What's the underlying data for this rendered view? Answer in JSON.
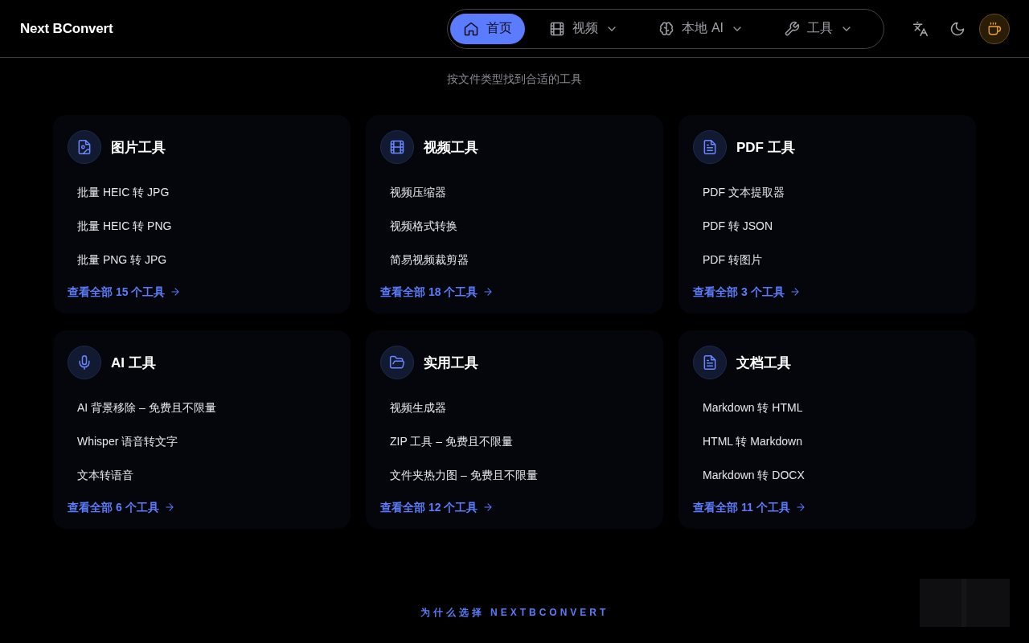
{
  "header": {
    "logo": "Next BConvert",
    "nav": [
      {
        "label": "首页",
        "selected": true,
        "dropdown": false
      },
      {
        "label": "视频",
        "selected": false,
        "dropdown": true
      },
      {
        "label": "本地 AI",
        "selected": false,
        "dropdown": true
      },
      {
        "label": "工具",
        "selected": false,
        "dropdown": true
      }
    ]
  },
  "section": {
    "subtitle": "按文件类型找到合适的工具"
  },
  "categories": [
    {
      "title": "图片工具",
      "tools": [
        "批量 HEIC 转 JPG",
        "批量 HEIC 转 PNG",
        "批量 PNG 转 JPG"
      ],
      "link": "查看全部 15 个工具"
    },
    {
      "title": "视频工具",
      "tools": [
        "视频压缩器",
        "视频格式转换",
        "简易视频裁剪器"
      ],
      "link": "查看全部 18 个工具"
    },
    {
      "title": "PDF 工具",
      "tools": [
        "PDF 文本提取器",
        "PDF 转 JSON",
        "PDF 转图片"
      ],
      "link": "查看全部 3 个工具"
    },
    {
      "title": "AI 工具",
      "tools": [
        "AI 背景移除 – 免费且不限量",
        "Whisper 语音转文字",
        "文本转语音"
      ],
      "link": "查看全部 6 个工具"
    },
    {
      "title": "实用工具",
      "tools": [
        "视频生成器",
        "ZIP 工具 – 免费且不限量",
        "文件夹热力图 – 免费且不限量"
      ],
      "link": "查看全部 12 个工具"
    },
    {
      "title": "文档工具",
      "tools": [
        "Markdown 转 HTML",
        "HTML 转 Markdown",
        "Markdown 转 DOCX"
      ],
      "link": "查看全部 11 个工具"
    }
  ],
  "why": {
    "kicker": "为什么选择 NEXTBCONVERT"
  }
}
